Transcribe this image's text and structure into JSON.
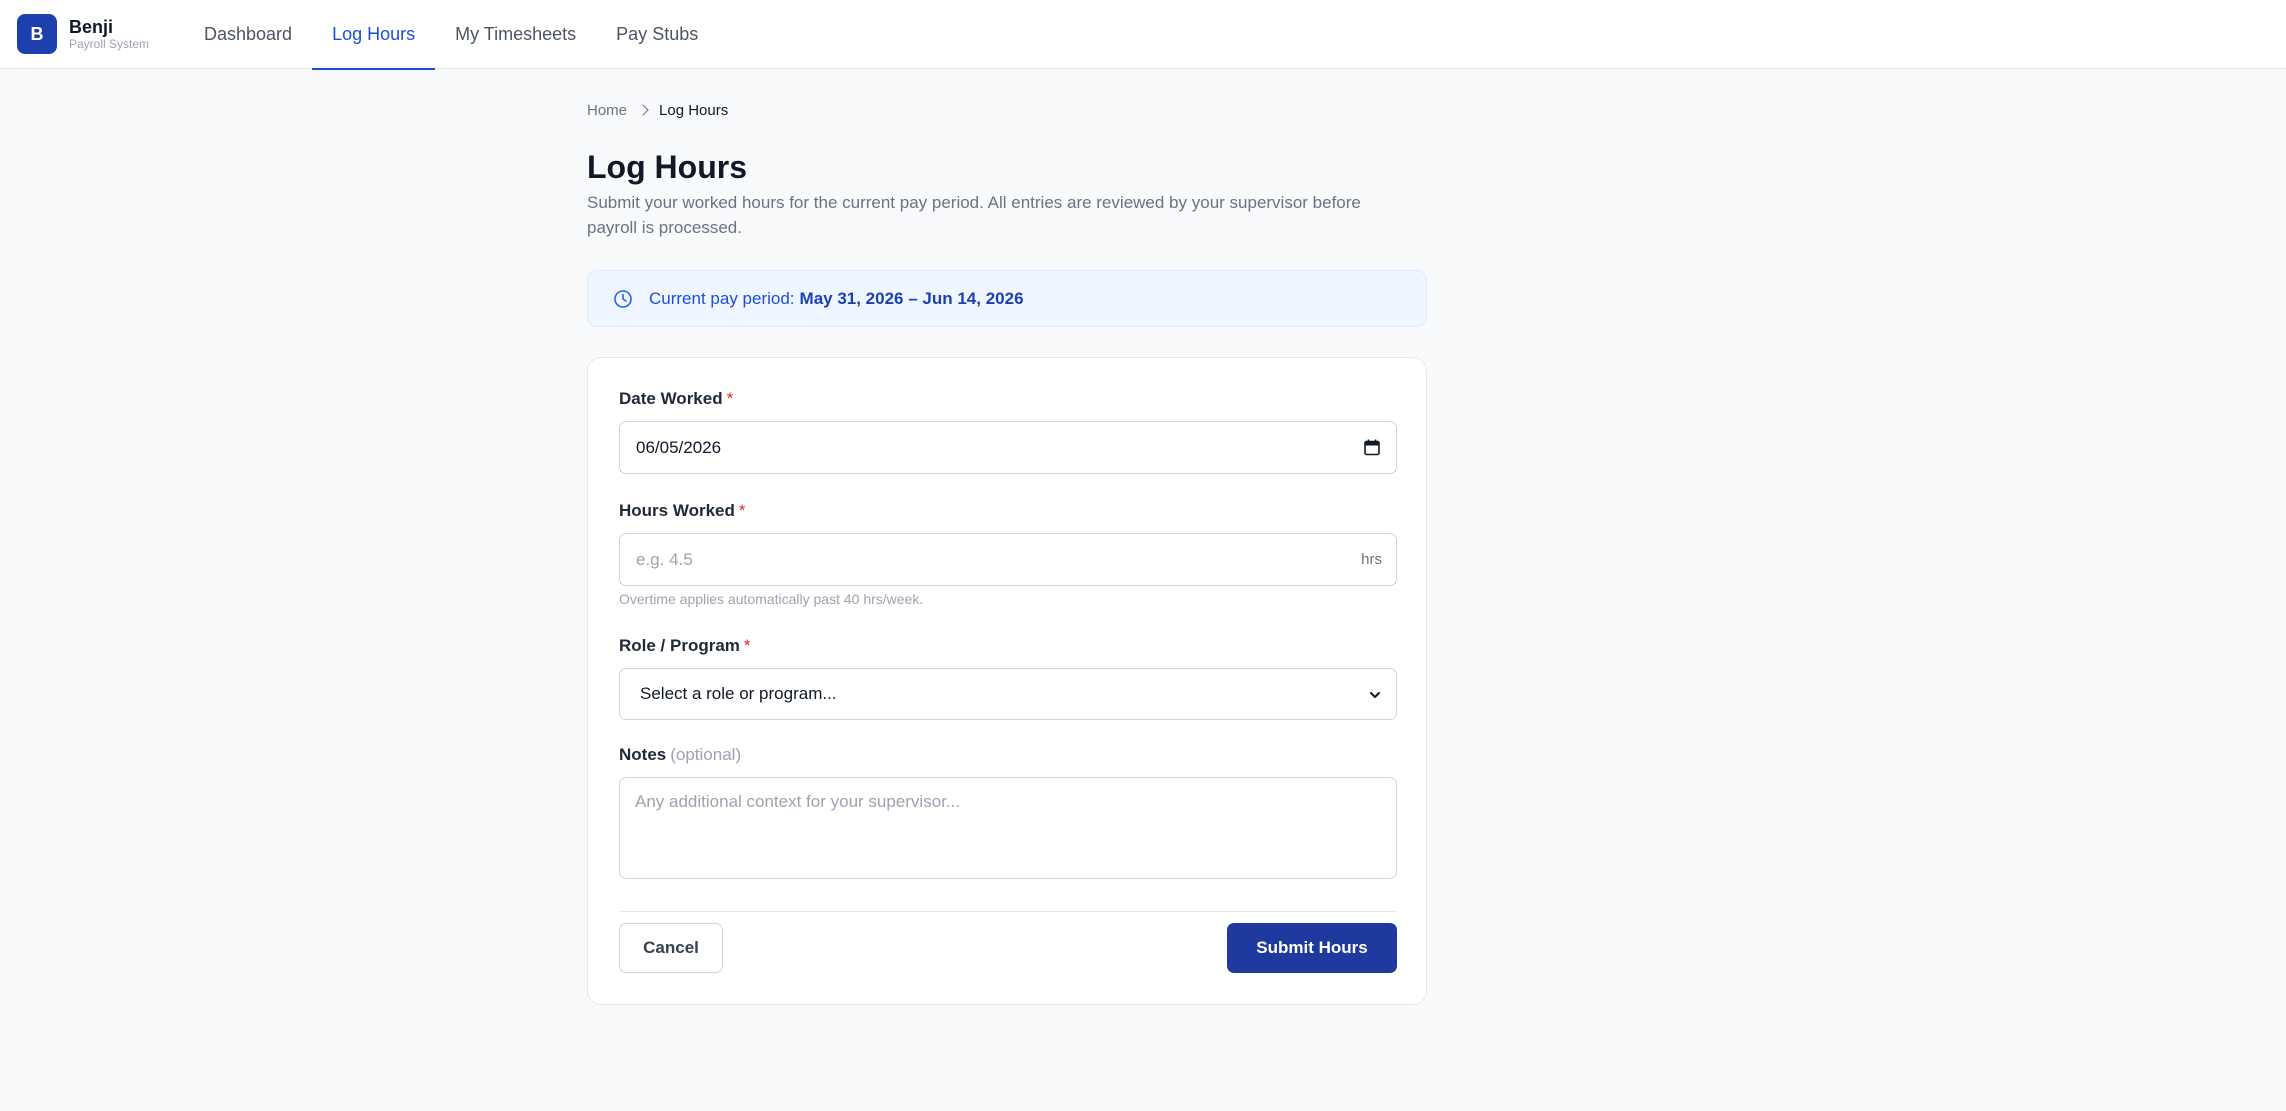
{
  "brand": {
    "logo_letter": "B",
    "name": "Benji",
    "subtitle": "Payroll System",
    "accent": "#1e40af"
  },
  "nav": {
    "items": [
      {
        "label": "Dashboard",
        "active": false
      },
      {
        "label": "Log Hours",
        "active": true
      },
      {
        "label": "My Timesheets",
        "active": false
      },
      {
        "label": "Pay Stubs",
        "active": false
      }
    ]
  },
  "breadcrumb": {
    "home": "Home",
    "current": "Log Hours"
  },
  "page": {
    "title": "Log Hours",
    "description": "Submit your worked hours for the current pay period. All entries are reviewed by your supervisor before payroll is processed."
  },
  "period": {
    "label": "Current pay period:",
    "value": "May 31, 2026 – Jun 14, 2026",
    "icon": "clock-icon"
  },
  "form": {
    "date": {
      "label": "Date Worked",
      "required_mark": "*",
      "value": "06/05/2026",
      "icon": "calendar-icon"
    },
    "hours": {
      "label": "Hours Worked",
      "required_mark": "*",
      "placeholder": "e.g. 4.5",
      "suffix": "hrs",
      "helper": "Overtime applies automatically past 40 hrs/week."
    },
    "role": {
      "label": "Role / Program",
      "required_mark": "*",
      "selected": "Select a role or program..."
    },
    "notes": {
      "label": "Notes",
      "optional": "(optional)",
      "placeholder": "Any additional context for your supervisor..."
    },
    "cancel_label": "Cancel",
    "submit_label": "Submit Hours"
  }
}
